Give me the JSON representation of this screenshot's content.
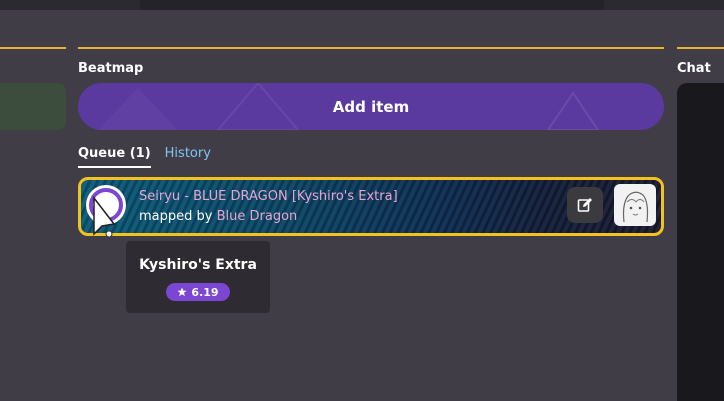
{
  "sections": {
    "beatmap_label": "Beatmap",
    "chat_label": "Chat"
  },
  "add_item_label": "Add item",
  "tabs": [
    {
      "label": "Queue (1)",
      "active": true
    },
    {
      "label": "History",
      "active": false
    }
  ],
  "queue_item": {
    "title": "Seiryu - BLUE DRAGON [Kyshiro's Extra]",
    "mapped_by_prefix": "mapped by",
    "mapper": "Blue Dragon"
  },
  "tooltip": {
    "difficulty_name": "Kyshiro's Extra",
    "star_rating": "6.19"
  },
  "colors": {
    "accent_gold": "#f4c21f",
    "section_line": "#e5b53a",
    "purple": "#5b3aa0",
    "star_badge": "#7a46d2",
    "link_blue": "#7ec6f0",
    "pink_text": "#e8a6d3"
  },
  "icons": {
    "edit": "edit-icon",
    "star": "star-icon",
    "mode": "osu-mode-icon",
    "cursor": "cursor-icon"
  }
}
